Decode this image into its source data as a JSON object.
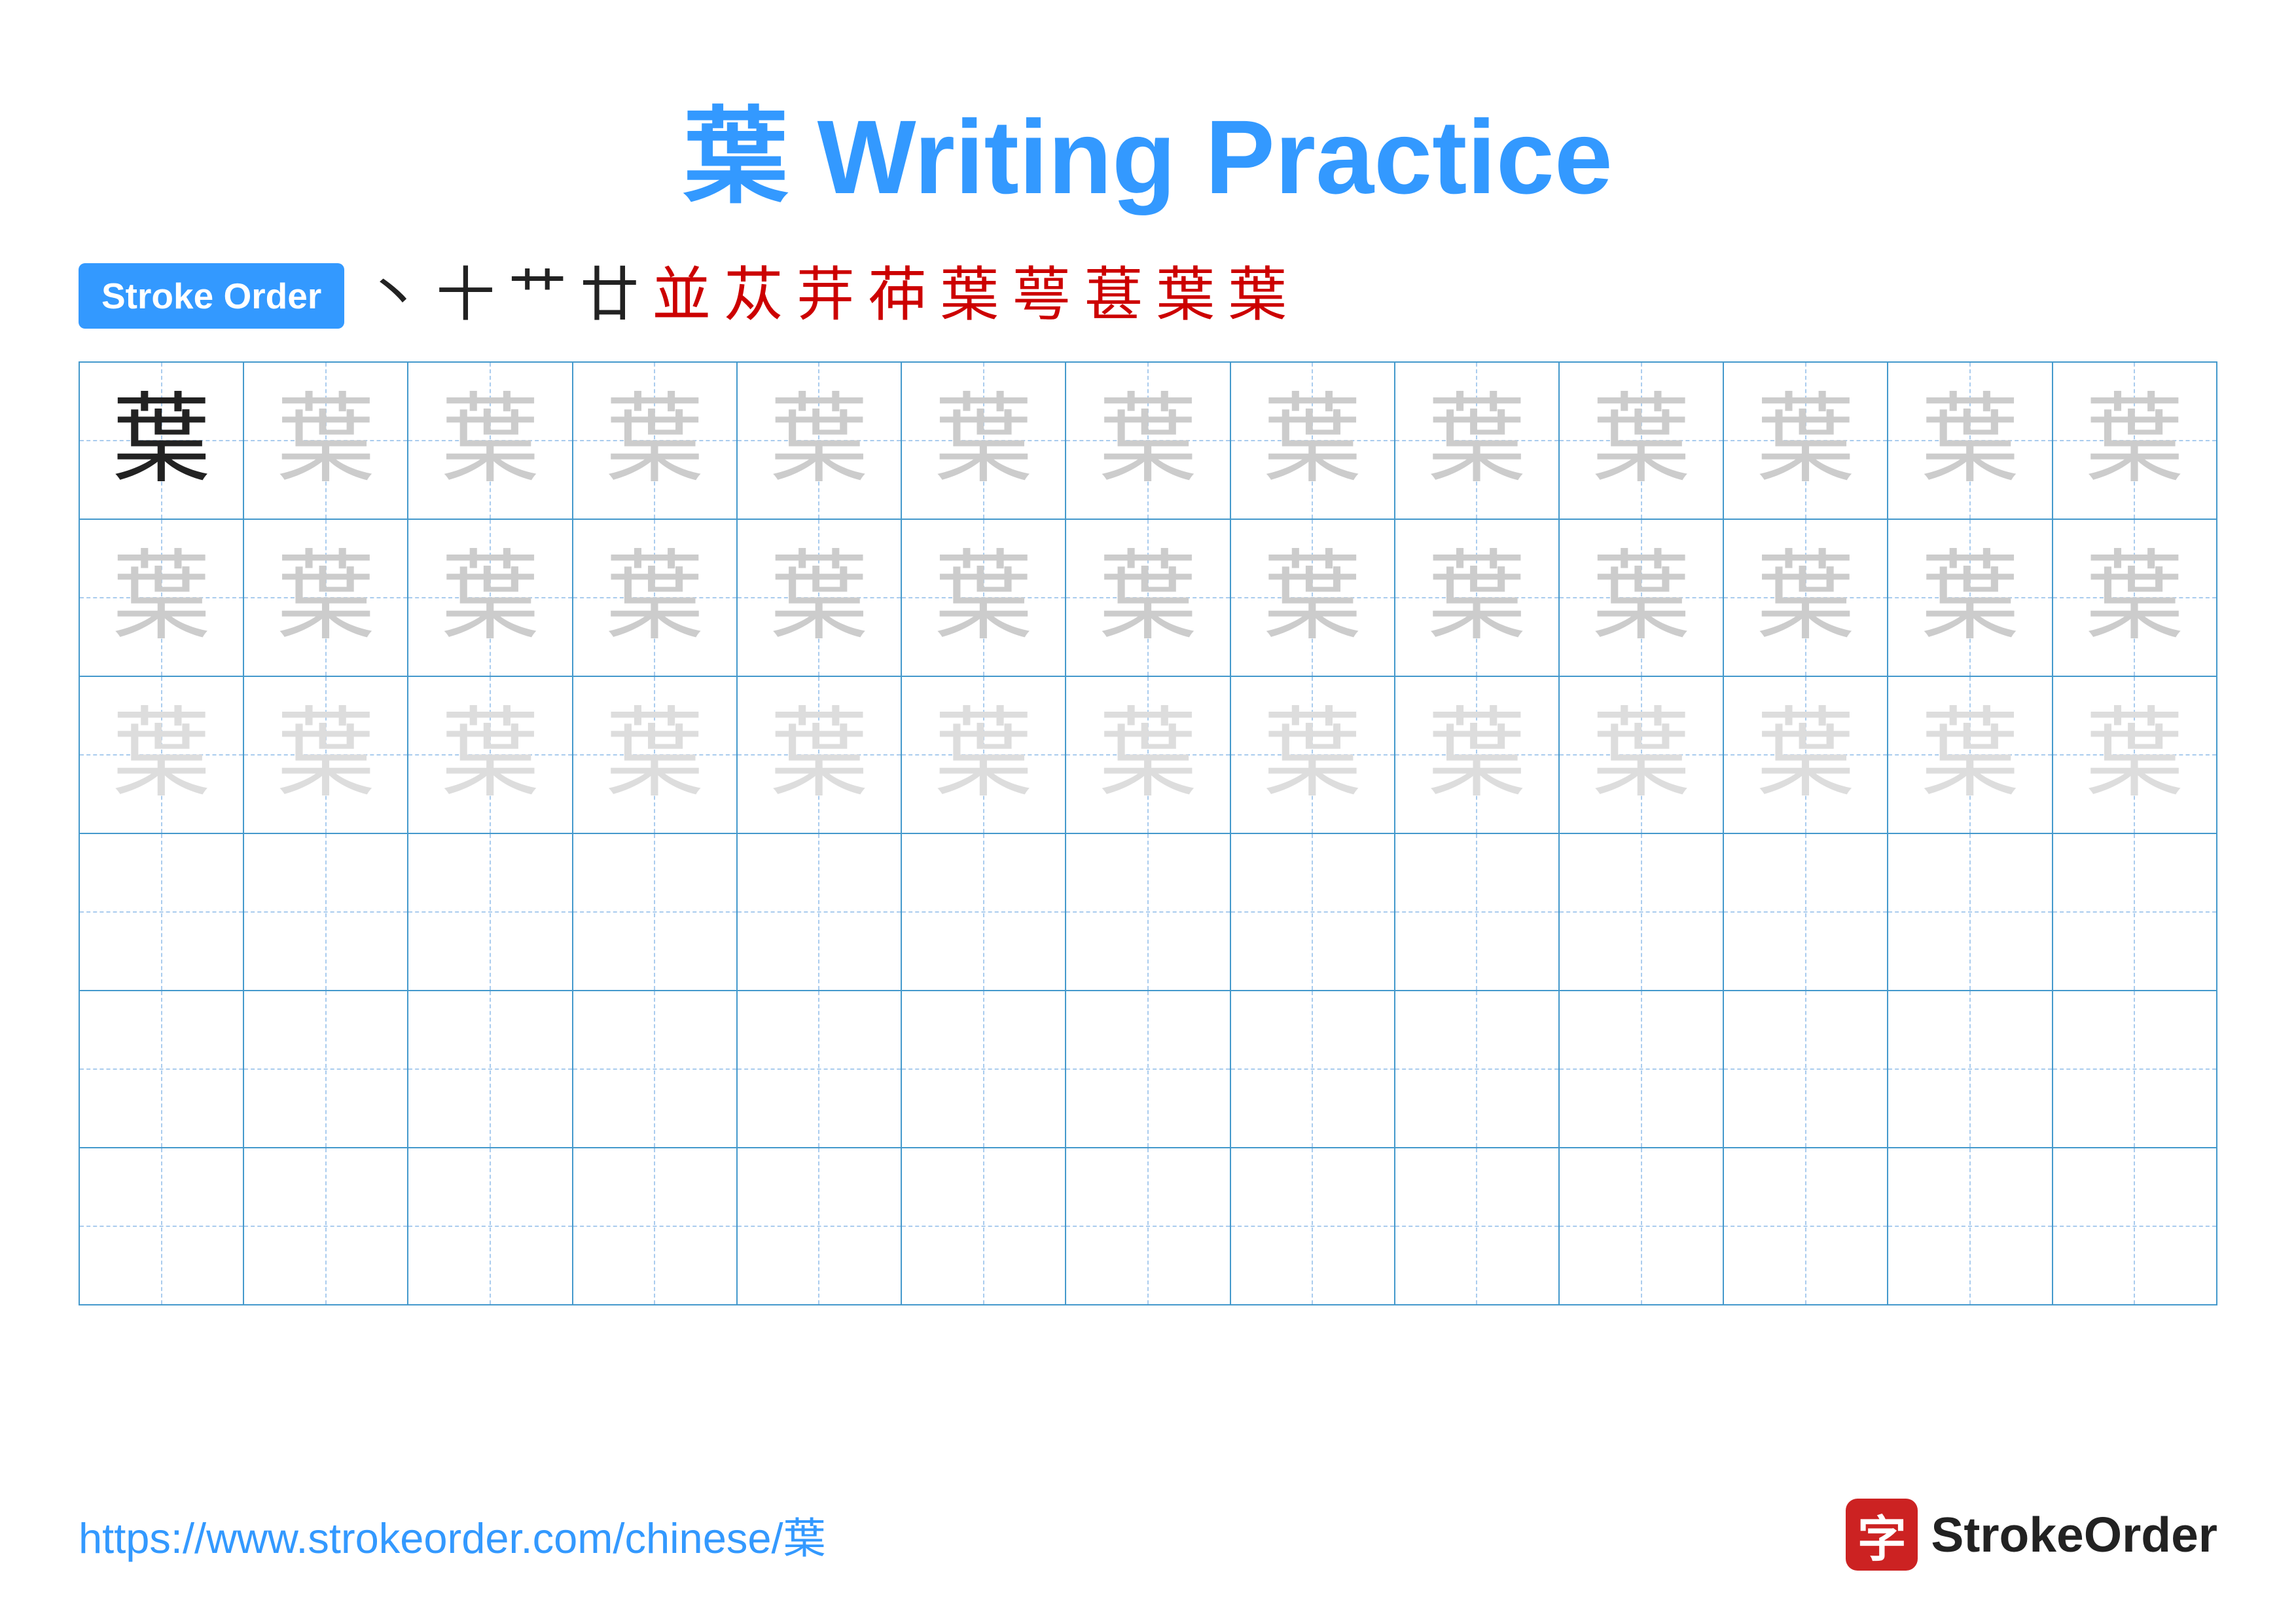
{
  "title": {
    "char": "葉",
    "text": " Writing Practice"
  },
  "stroke_order": {
    "badge_label": "Stroke Order",
    "strokes": [
      {
        "char": "丶",
        "color": "black"
      },
      {
        "char": "十",
        "color": "black"
      },
      {
        "char": "艹",
        "color": "black"
      },
      {
        "char": "廿",
        "color": "black"
      },
      {
        "char": "並",
        "color": "red"
      },
      {
        "char": "苁",
        "color": "red"
      },
      {
        "char": "茾",
        "color": "red"
      },
      {
        "char": "茽",
        "color": "red"
      },
      {
        "char": "葉",
        "color": "red"
      },
      {
        "char": "萼",
        "color": "red"
      },
      {
        "char": "葚",
        "color": "red"
      },
      {
        "char": "葉",
        "color": "red"
      },
      {
        "char": "葉",
        "color": "red"
      }
    ]
  },
  "grid": {
    "rows": 6,
    "cols": 13,
    "char": "葉",
    "practice_char": "葉"
  },
  "footer": {
    "url": "https://www.strokeorder.com/chinese/葉",
    "brand_icon": "字",
    "brand_name": "StrokeOrder"
  }
}
